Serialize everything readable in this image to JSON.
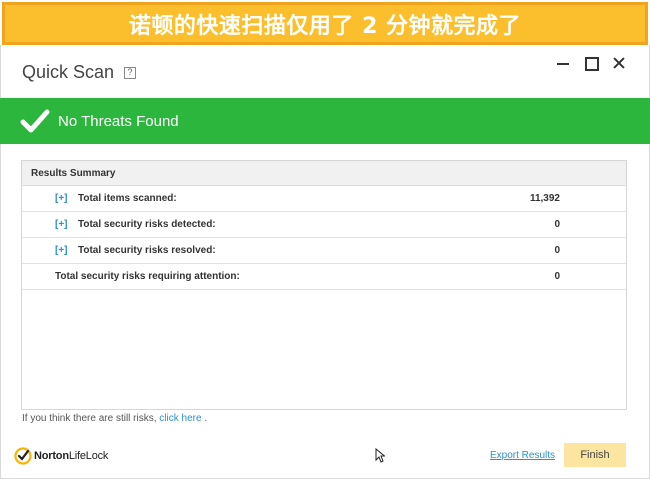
{
  "banner": {
    "text": "诺顿的快速扫描仅用了 2 分钟就完成了"
  },
  "window": {
    "title": "Quick Scan",
    "help_label": "?"
  },
  "status": {
    "text": "No Threats Found",
    "color": "#2db63e"
  },
  "results": {
    "header": "Results Summary",
    "expander_label": "[+]",
    "rows": [
      {
        "label": "Total items scanned:",
        "value": "11,392",
        "expandable": true
      },
      {
        "label": "Total security risks detected:",
        "value": "0",
        "expandable": true
      },
      {
        "label": "Total security risks resolved:",
        "value": "0",
        "expandable": true
      },
      {
        "label": "Total security risks requiring attention:",
        "value": "0",
        "expandable": false
      }
    ]
  },
  "hint": {
    "text": "If you think there are still risks,",
    "link": "click here",
    "suffix": "."
  },
  "footer": {
    "logo_text_bold": "Norton",
    "logo_text_regular": "LifeLock",
    "export_label": "Export Results",
    "finish_label": "Finish"
  },
  "colors": {
    "banner": "#fbbf2d",
    "success": "#2db63e",
    "link": "#2c8fcf",
    "finish": "#fbe5a0"
  },
  "icons": {
    "status": "checkmark-icon",
    "logo": "norton-check-icon",
    "cursor": "mouse-pointer-icon"
  }
}
